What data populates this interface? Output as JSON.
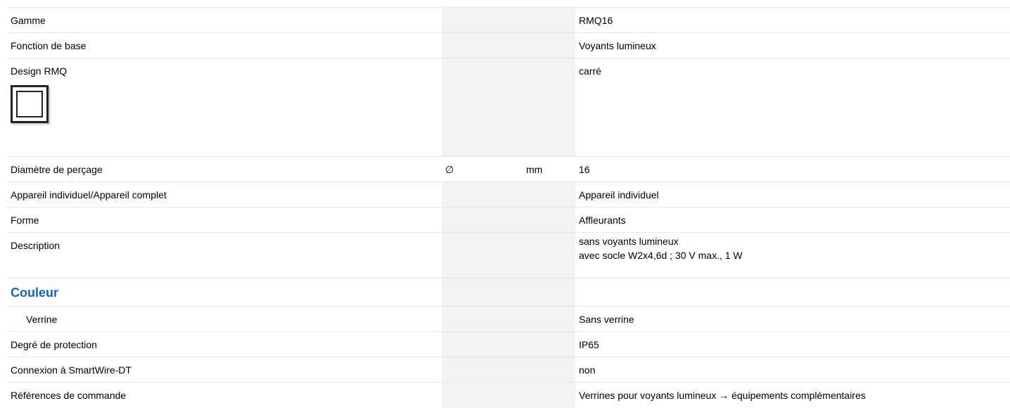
{
  "rows": [
    {
      "label": "Gamme",
      "symbol": "",
      "unit": "",
      "value": "RMQ16"
    },
    {
      "label": "Fonction de base",
      "symbol": "",
      "unit": "",
      "value": "Voyants lumineux"
    },
    {
      "label": "Design RMQ",
      "symbol": "",
      "unit": "",
      "value": "carré",
      "icon": "square-design-icon"
    },
    {
      "label": "Diamètre de perçage",
      "symbol": "∅",
      "unit": "mm",
      "value": "16"
    },
    {
      "label": "Appareil individuel/Appareil complet",
      "symbol": "",
      "unit": "",
      "value": "Appareil individuel"
    },
    {
      "label": "Forme",
      "symbol": "",
      "unit": "",
      "value": "Affleurants"
    },
    {
      "label": "Description",
      "symbol": "",
      "unit": "",
      "value_lines": [
        "sans voyants lumineux",
        "avec socle W2x4,6d ; 30 V max., 1 W"
      ]
    }
  ],
  "group": {
    "title": "Couleur",
    "color": "#1565c0",
    "rows": [
      {
        "label": "Verrine",
        "symbol": "",
        "unit": "",
        "value": "Sans verrine"
      }
    ]
  },
  "rows_after": [
    {
      "label": "Degré de protection",
      "symbol": "",
      "unit": "",
      "value": "IP65"
    },
    {
      "label": "Connexion à SmartWire-DT",
      "symbol": "",
      "unit": "",
      "value": "non"
    },
    {
      "label": "Références de commande",
      "symbol": "",
      "unit": "",
      "value": "Verrines pour voyants lumineux → équipements complémentaires"
    }
  ],
  "colors": {
    "shaded_column": "#f1f2f4",
    "divider": "#e8e8e8"
  }
}
